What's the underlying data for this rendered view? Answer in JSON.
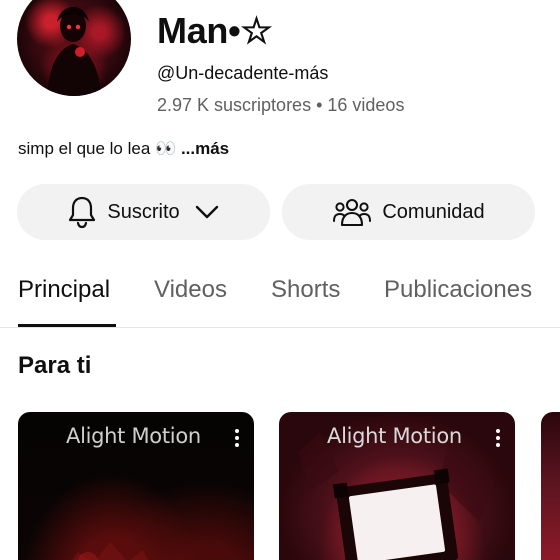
{
  "channel": {
    "name": "Man•☆",
    "handle": "@Un-decadente-más",
    "subscribers": "2.97 K suscriptores",
    "separator": "•",
    "videos": "16 videos",
    "description": "simp el que lo lea 👀",
    "more_label": "...más"
  },
  "actions": {
    "subscribed_label": "Suscrito",
    "subscribed_icon": "bell-icon",
    "dropdown_icon": "chevron-down-icon",
    "community_label": "Comunidad",
    "community_icon": "people-icon"
  },
  "tabs": [
    {
      "label": "Principal",
      "active": true
    },
    {
      "label": "Videos",
      "active": false
    },
    {
      "label": "Shorts",
      "active": false
    },
    {
      "label": "Publicaciones",
      "active": false
    }
  ],
  "section": {
    "title": "Para ti"
  },
  "videos": [
    {
      "watermark": "Alight Motion"
    },
    {
      "watermark": "Alight Motion"
    }
  ],
  "colors": {
    "text_primary": "#0f0f0f",
    "text_secondary": "#606060",
    "pill_background": "#f2f2f2",
    "accent_red": "#c8202c"
  }
}
